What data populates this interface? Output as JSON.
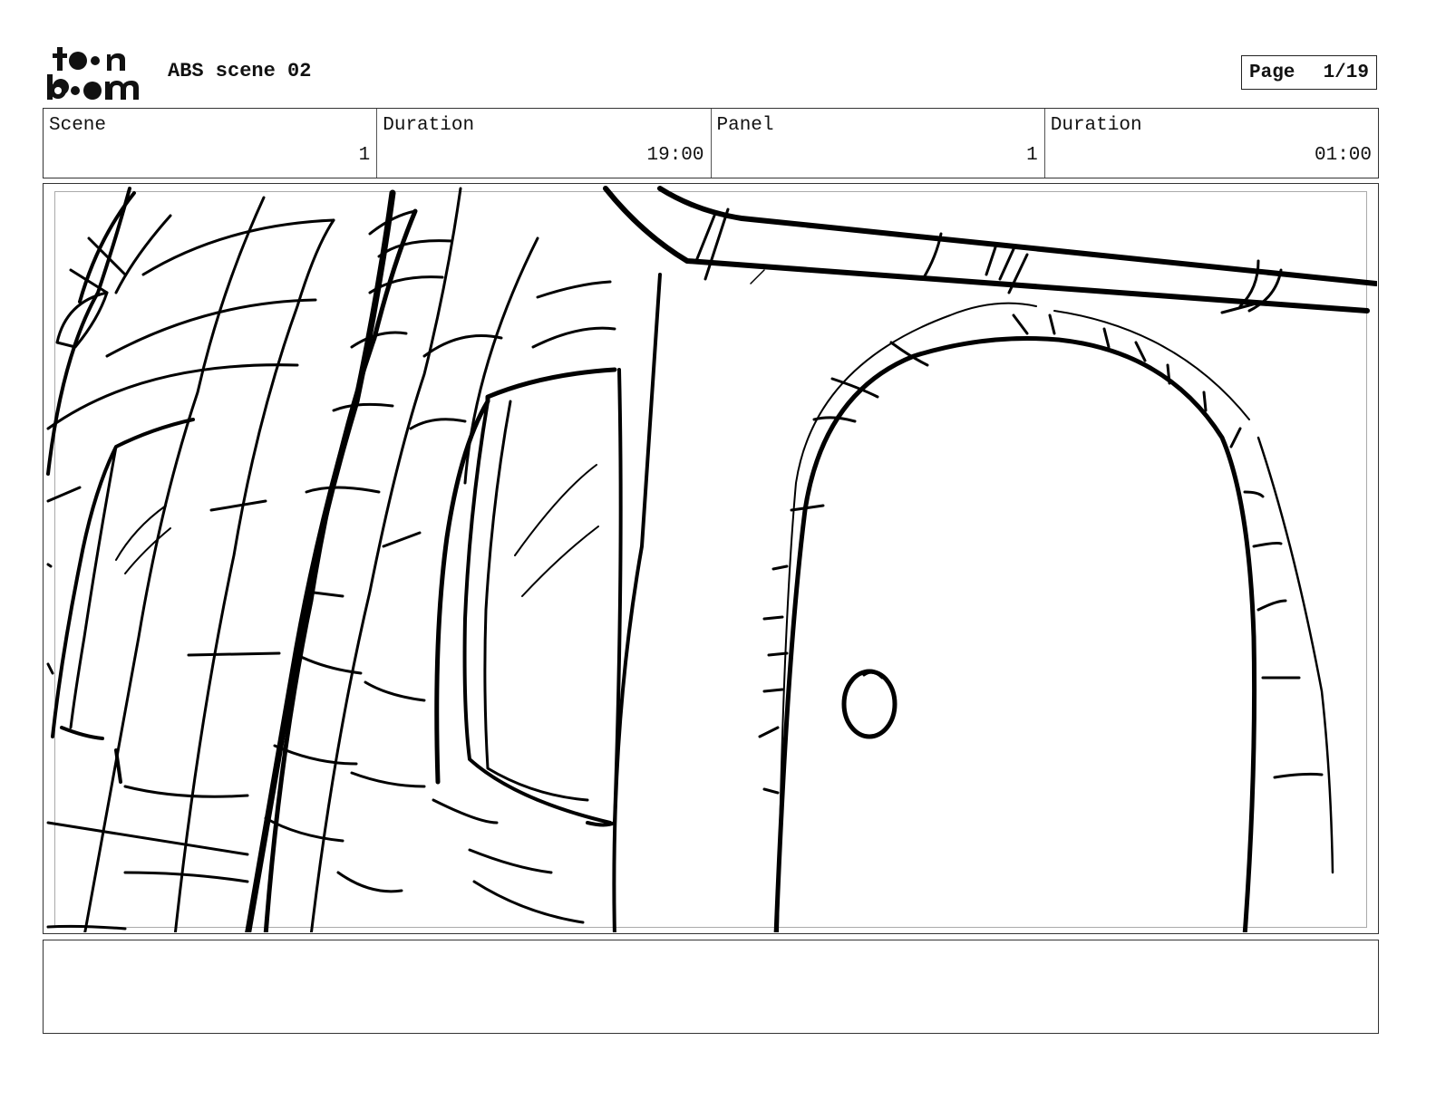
{
  "header": {
    "logo_text": "toon boom",
    "title": "ABS scene 02",
    "page_label": "Page",
    "page_value": "1/19"
  },
  "info": [
    {
      "label": "Scene",
      "value": "1"
    },
    {
      "label": "Duration",
      "value": "19:00"
    },
    {
      "label": "Panel",
      "value": "1"
    },
    {
      "label": "Duration",
      "value": "01:00"
    }
  ],
  "panel": {
    "image": "sketch-drawing of stone archway door with handle and stone walls"
  },
  "notes": {
    "text": ""
  }
}
